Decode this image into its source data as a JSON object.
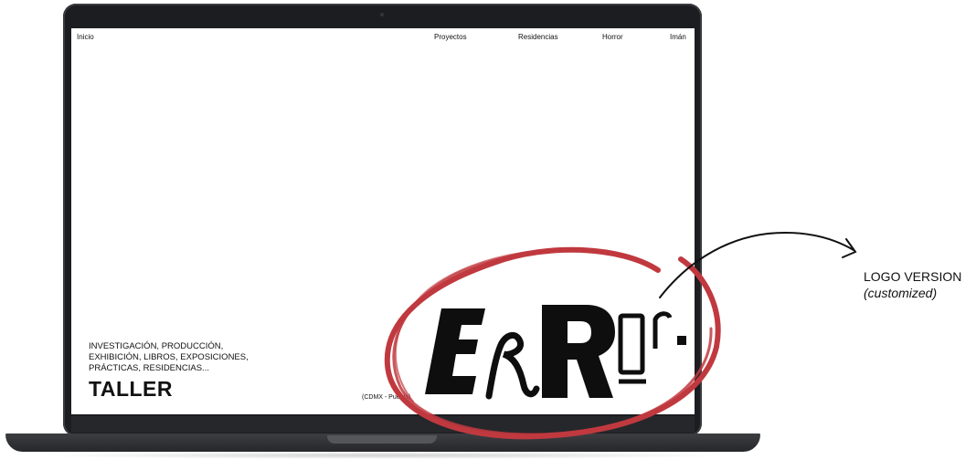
{
  "nav": {
    "home": "Inicio",
    "projects": "Proyectos",
    "residencies": "Residencias",
    "horror": "Horror",
    "iman": "Imán"
  },
  "hero": {
    "description_lines": [
      "INVESTIGACIÓN, PRODUCCIÓN,",
      "EXHIBICIÓN, LIBROS, EXPOSICIONES,",
      "PRÁCTICAS, RESIDENCIAS..."
    ],
    "title": "TALLER",
    "location": "(CDMX - Puebla)"
  },
  "logo": {
    "wordmark": "ERROr."
  },
  "annotation": {
    "line1": "LOGO VERSION",
    "line2": "(customized)"
  },
  "colors": {
    "circle": "#c0393f",
    "device": "#1c1d20",
    "ink": "#111111"
  },
  "icons": [
    "hand-drawn-circle-icon",
    "curved-arrow-icon"
  ]
}
